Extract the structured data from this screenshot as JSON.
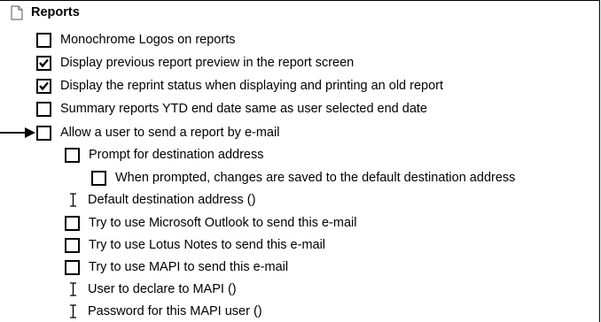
{
  "section": {
    "title": "Reports",
    "icon": "document-icon"
  },
  "options": [
    {
      "label": "Monochrome Logos on reports",
      "type": "checkbox",
      "checked": false
    },
    {
      "label": "Display previous report preview in the report screen",
      "type": "checkbox",
      "checked": true
    },
    {
      "label": "Display the reprint status when displaying and printing an old report",
      "type": "checkbox",
      "checked": true
    },
    {
      "label": "Summary reports YTD end date same as user selected end date",
      "type": "checkbox",
      "checked": false
    },
    {
      "label": "Allow a user to send a report by e-mail",
      "type": "checkbox",
      "checked": false,
      "highlighted": true
    },
    {
      "label": "Prompt for destination address",
      "type": "checkbox",
      "checked": false
    },
    {
      "label": "When prompted, changes are saved to the default destination address",
      "type": "checkbox",
      "checked": false
    },
    {
      "label": "Default destination address ()",
      "type": "text-field"
    },
    {
      "label": "Try to use Microsoft Outlook to send this e-mail",
      "type": "checkbox",
      "checked": false
    },
    {
      "label": "Try to use Lotus Notes to send this e-mail",
      "type": "checkbox",
      "checked": false
    },
    {
      "label": "Try to use MAPI to send this e-mail",
      "type": "checkbox",
      "checked": false
    },
    {
      "label": "User to declare to MAPI ()",
      "type": "text-field"
    },
    {
      "label": "Password for this MAPI user ()",
      "type": "text-field"
    }
  ],
  "colors": {
    "line": "#000000",
    "background": "#ffffff"
  }
}
